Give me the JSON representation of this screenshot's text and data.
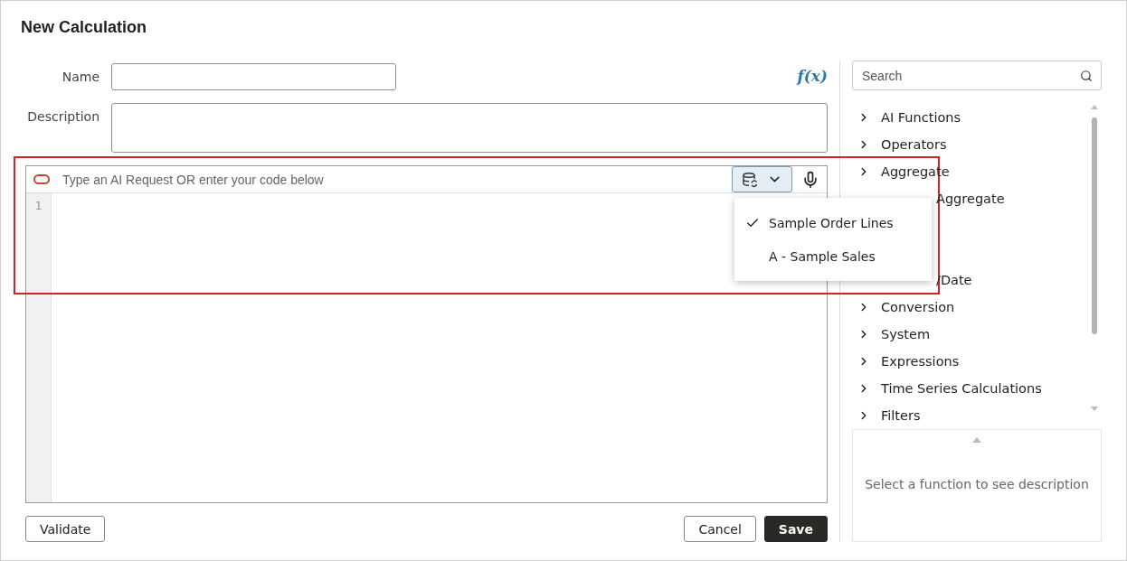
{
  "dialog": {
    "title": "New Calculation"
  },
  "form": {
    "name": {
      "label": "Name"
    },
    "description": {
      "label": "Description"
    },
    "function_button": "f(x)"
  },
  "editor": {
    "prompt_placeholder": "Type an AI Request OR enter your code below",
    "line_numbers": [
      "1"
    ],
    "source_menu": {
      "expanded": true,
      "items": [
        {
          "label": "Sample Order Lines",
          "selected": true
        },
        {
          "label": "A - Sample Sales",
          "selected": false
        }
      ]
    }
  },
  "buttons": {
    "validate": "Validate",
    "cancel": "Cancel",
    "save": "Save"
  },
  "functions": {
    "search": {
      "placeholder": "Search"
    },
    "categories": [
      {
        "kind": "category",
        "label": "AI Functions"
      },
      {
        "kind": "category",
        "label": "Operators"
      },
      {
        "kind": "category",
        "label": "Aggregate"
      },
      {
        "kind": "partial",
        "label": "Aggregate"
      },
      {
        "kind": "covered"
      },
      {
        "kind": "covered"
      },
      {
        "kind": "partial",
        "label": "/Date"
      },
      {
        "kind": "category",
        "label": "Conversion"
      },
      {
        "kind": "category",
        "label": "System"
      },
      {
        "kind": "category",
        "label": "Expressions"
      },
      {
        "kind": "category",
        "label": "Time Series Calculations"
      },
      {
        "kind": "category",
        "label": "Filters"
      }
    ],
    "description_placeholder": "Select a function to see description"
  },
  "annotation": {
    "highlight_box": true
  }
}
